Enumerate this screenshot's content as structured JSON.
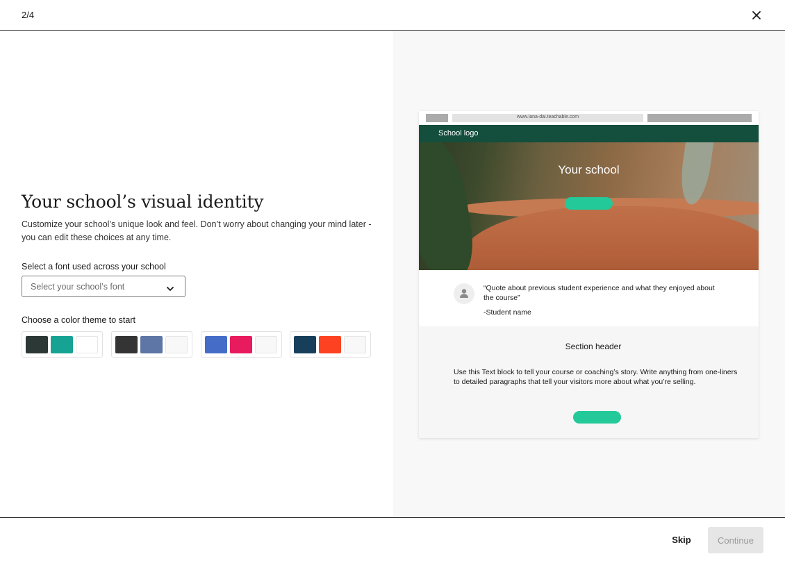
{
  "header": {
    "step": "2/4"
  },
  "main": {
    "title": "Your school’s visual identity",
    "description": "Customize your school’s unique look and feel. Don’t worry about changing your mind later - you can edit these choices at any time.",
    "font_label": "Select a font used across your school",
    "font_select": {
      "placeholder": "Select your school’s font"
    },
    "theme_label": "Choose a color theme to start",
    "themes": [
      {
        "colors": [
          "#2b3836",
          "#16a394",
          "#ffffff"
        ]
      },
      {
        "colors": [
          "#343434",
          "#5d76a5",
          "#f8f8f8"
        ]
      },
      {
        "colors": [
          "#456dc8",
          "#e81b5e",
          "#f8f8f8"
        ]
      },
      {
        "colors": [
          "#173f5b",
          "#fc4221",
          "#f8f8f8"
        ]
      }
    ]
  },
  "preview": {
    "url": "www.lana-dai.teachable.com",
    "logo": "School logo",
    "hero_title": "Your school",
    "quote": "“Quote about previous student experience and what they enjoyed about the course”",
    "quote_author": "-Student name",
    "section_header": "Section header",
    "section_body": "Use this Text block to tell your course or coaching’s story. Write anything from one-liners to detailed paragraphs that tell your visitors more about what you’re selling.",
    "accent_color": "#23c999",
    "nav_color": "#134f3c"
  },
  "footer": {
    "skip_label": "Skip",
    "continue_label": "Continue"
  }
}
